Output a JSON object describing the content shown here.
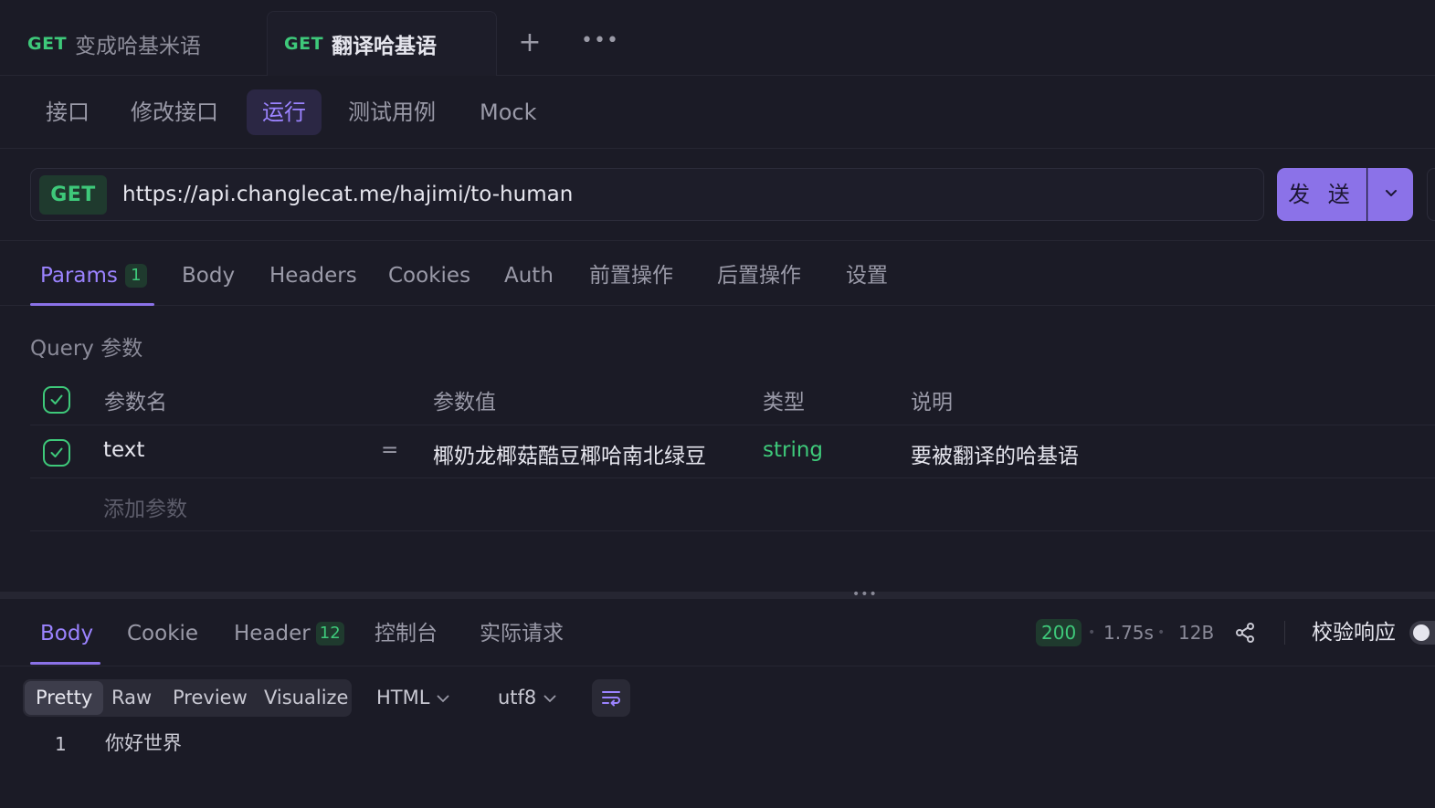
{
  "doc_tabs": [
    {
      "method": "GET",
      "title": "变成哈基米语"
    },
    {
      "method": "GET",
      "title": "翻译哈基语"
    }
  ],
  "doc_actions": {
    "add": "+",
    "more": "•••"
  },
  "mode_tabs": [
    "接口",
    "修改接口",
    "运行",
    "测试用例",
    "Mock"
  ],
  "mode_active": "运行",
  "request": {
    "method": "GET",
    "url": "https://api.changlecat.me/hajimi/to-human",
    "send_label": "发 送"
  },
  "request_tabs": [
    {
      "label": "Params",
      "badge": "1"
    },
    {
      "label": "Body"
    },
    {
      "label": "Headers"
    },
    {
      "label": "Cookies"
    },
    {
      "label": "Auth"
    },
    {
      "label": "前置操作"
    },
    {
      "label": "后置操作"
    },
    {
      "label": "设置"
    }
  ],
  "query": {
    "section_label": "Query 参数",
    "headers": {
      "name": "参数名",
      "value": "参数值",
      "type": "类型",
      "desc": "说明"
    },
    "rows": [
      {
        "name": "text",
        "eq": "=",
        "value": "椰奶龙椰菇酷豆椰哈南北绿豆",
        "type": "string",
        "desc": "要被翻译的哈基语",
        "checked": true
      }
    ],
    "add_placeholder": "添加参数"
  },
  "splitter_handle": "•••",
  "response_tabs": [
    {
      "label": "Body"
    },
    {
      "label": "Cookie"
    },
    {
      "label": "Header",
      "badge": "12"
    },
    {
      "label": "控制台"
    },
    {
      "label": "实际请求"
    }
  ],
  "response_meta": {
    "status": "200",
    "time": "1.75s",
    "size": "12B",
    "separator": "•",
    "validate_label": "校验响应"
  },
  "format_modes": [
    "Pretty",
    "Raw",
    "Preview",
    "Visualize"
  ],
  "format_active": "Pretty",
  "content_type": "HTML",
  "encoding": "utf8",
  "body_lines": [
    {
      "no": "1",
      "text": "你好世界"
    }
  ],
  "colors": {
    "background": "#1b1b26",
    "accent": "#8b72e8",
    "method_get": "#3ec97a"
  }
}
